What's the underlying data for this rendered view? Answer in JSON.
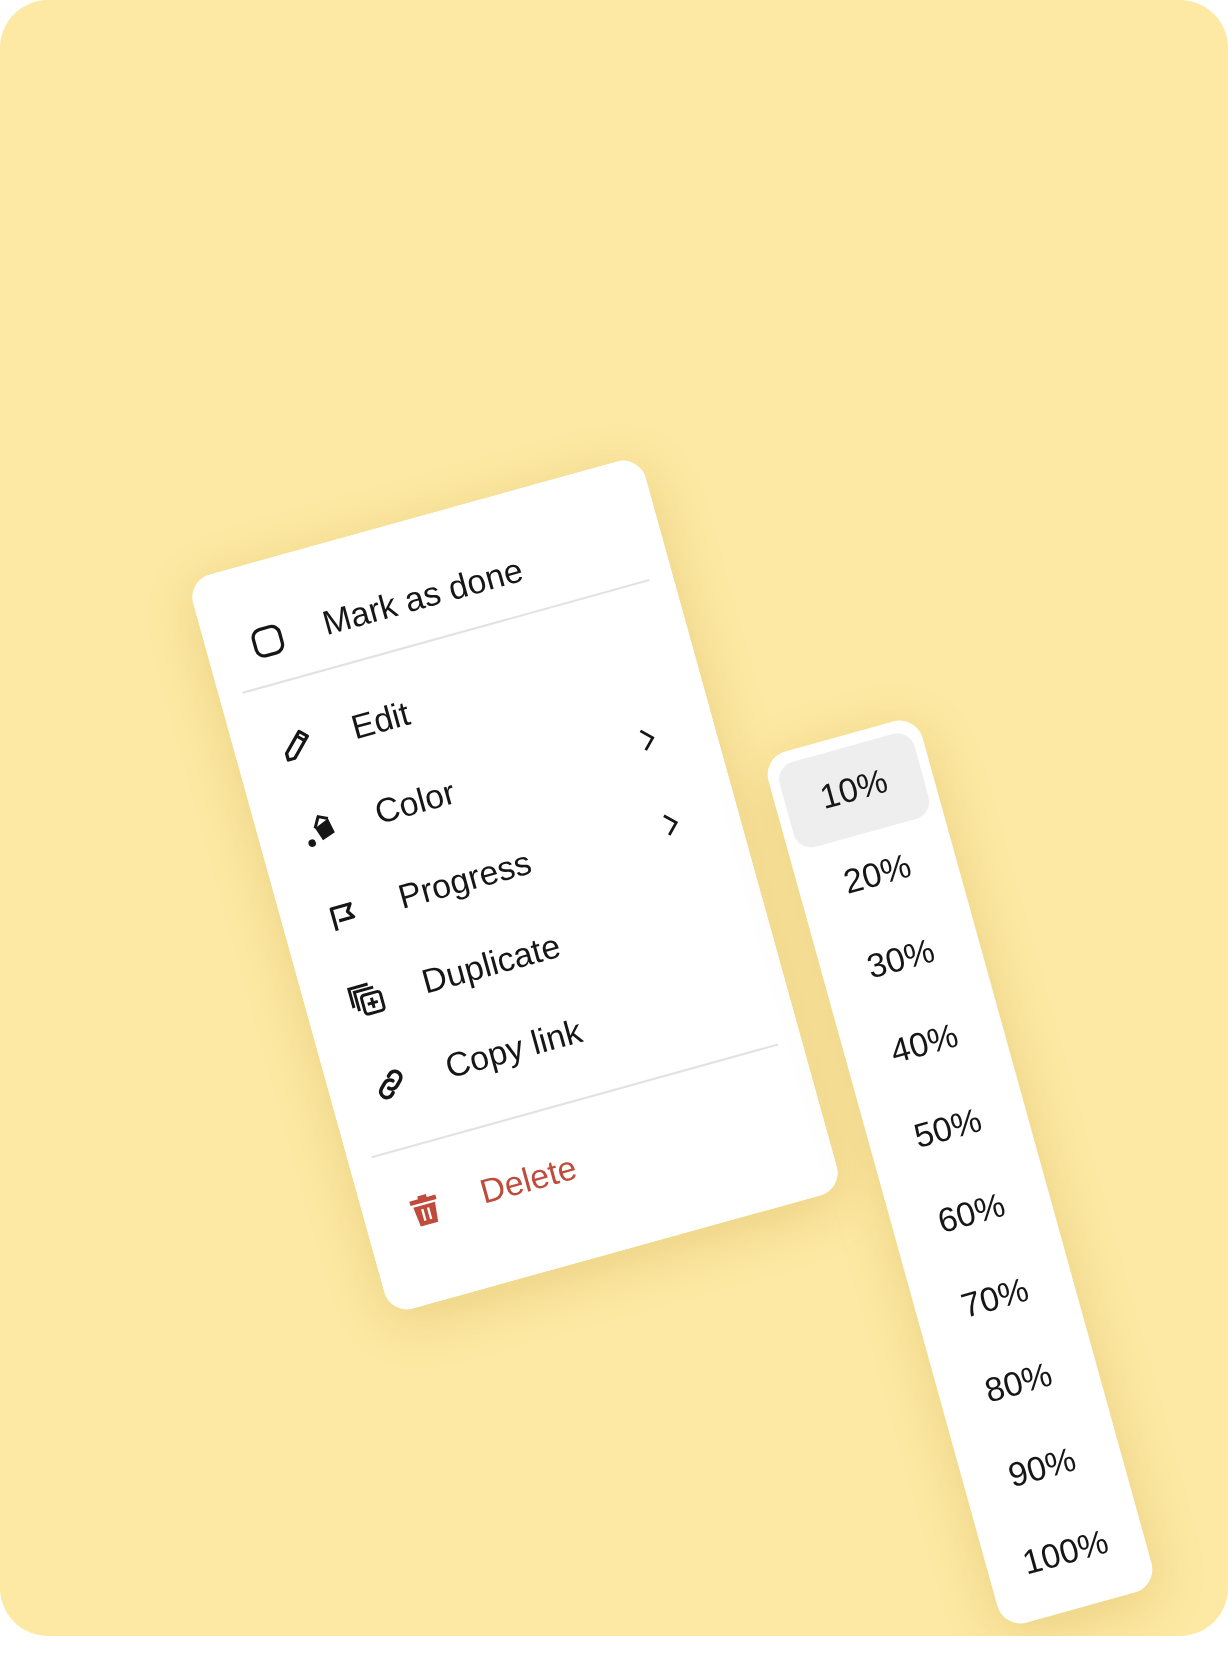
{
  "menu": {
    "checkbox_item": {
      "label": "Mark as done",
      "checked": false
    },
    "items": [
      {
        "label": "Edit",
        "submenu": false
      },
      {
        "label": "Color",
        "submenu": true
      },
      {
        "label": "Progress",
        "submenu": true
      },
      {
        "label": "Duplicate",
        "submenu": false
      },
      {
        "label": "Copy link",
        "submenu": false
      }
    ],
    "delete_item": {
      "label": "Delete"
    }
  },
  "progress_submenu": {
    "options": [
      {
        "label": "10%",
        "selected": true
      },
      {
        "label": "20%",
        "selected": false
      },
      {
        "label": "30%",
        "selected": false
      },
      {
        "label": "40%",
        "selected": false
      },
      {
        "label": "50%",
        "selected": false
      },
      {
        "label": "60%",
        "selected": false
      },
      {
        "label": "70%",
        "selected": false
      },
      {
        "label": "80%",
        "selected": false
      },
      {
        "label": "90%",
        "selected": false
      },
      {
        "label": "100%",
        "selected": false
      }
    ]
  }
}
